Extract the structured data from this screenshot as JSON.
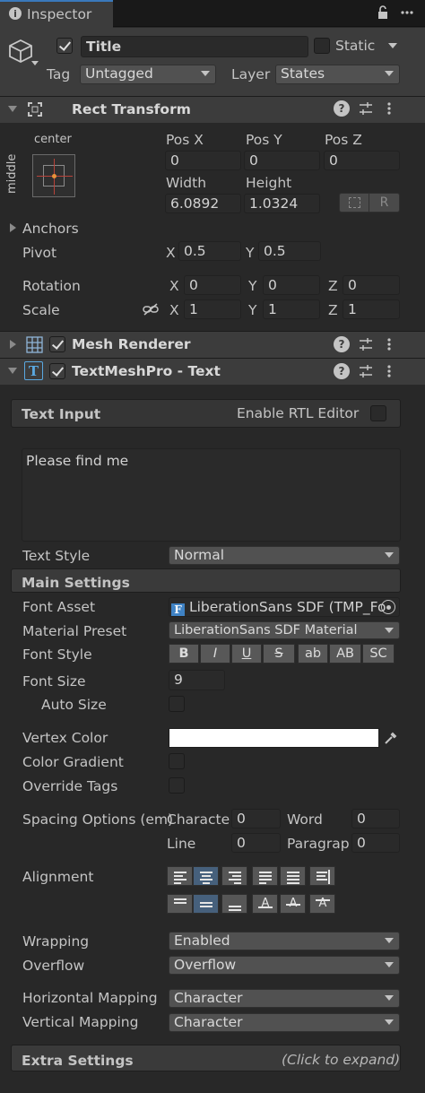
{
  "tab": {
    "title": "Inspector"
  },
  "header": {
    "active": true,
    "name": "Title",
    "static_label": "Static",
    "tag_label": "Tag",
    "tag_value": "Untagged",
    "layer_label": "Layer",
    "layer_value": "States"
  },
  "rect_transform": {
    "title": "Rect Transform",
    "anchor_h": "center",
    "anchor_v": "middle",
    "pos_x_label": "Pos X",
    "pos_x": "0",
    "pos_y_label": "Pos Y",
    "pos_y": "0",
    "pos_z_label": "Pos Z",
    "pos_z": "0",
    "width_label": "Width",
    "width": "6.0892",
    "height_label": "Height",
    "height": "1.0324",
    "r_button": "R",
    "anchors_label": "Anchors",
    "pivot_label": "Pivot",
    "pivot_x_label": "X",
    "pivot_x": "0.5",
    "pivot_y_label": "Y",
    "pivot_y": "0.5",
    "rotation_label": "Rotation",
    "rot_x_label": "X",
    "rot_x": "0",
    "rot_y_label": "Y",
    "rot_y": "0",
    "rot_z_label": "Z",
    "rot_z": "0",
    "scale_label": "Scale",
    "scale_x_label": "X",
    "scale_x": "1",
    "scale_y_label": "Y",
    "scale_y": "1",
    "scale_z_label": "Z",
    "scale_z": "1"
  },
  "mesh_renderer": {
    "title": "Mesh Renderer",
    "enabled": true
  },
  "tmp": {
    "title": "TextMeshPro - Text",
    "enabled": true,
    "text_input_label": "Text Input",
    "rtl_label": "Enable RTL Editor",
    "text": "Please find me",
    "text_style_label": "Text Style",
    "text_style": "Normal",
    "main_settings_label": "Main Settings",
    "font_asset_label": "Font Asset",
    "font_asset": "LiberationSans SDF (TMP_Fo",
    "material_preset_label": "Material Preset",
    "material_preset": "LiberationSans SDF Material",
    "font_style_label": "Font Style",
    "font_style_buttons": [
      "B",
      "I",
      "U",
      "S",
      "ab",
      "AB",
      "SC"
    ],
    "font_size_label": "Font Size",
    "font_size": "9",
    "auto_size_label": "Auto Size",
    "vertex_color_label": "Vertex Color",
    "vertex_color": "#ffffff",
    "color_gradient_label": "Color Gradient",
    "override_tags_label": "Override Tags",
    "spacing_label": "Spacing Options (em)",
    "char_label": "Characte",
    "char_value": "0",
    "word_label": "Word",
    "word_value": "0",
    "line_label": "Line",
    "line_value": "0",
    "para_label": "Paragrap",
    "para_value": "0",
    "alignment_label": "Alignment",
    "horizontal_alignment": "center",
    "vertical_alignment": "middle",
    "wrapping_label": "Wrapping",
    "wrapping": "Enabled",
    "overflow_label": "Overflow",
    "overflow": "Overflow",
    "hmap_label": "Horizontal Mapping",
    "hmap": "Character",
    "vmap_label": "Vertical Mapping",
    "vmap": "Character",
    "extra_settings_label": "Extra Settings",
    "extra_hint": "(Click to expand)"
  },
  "colors": {
    "accent_selected": "#46607c",
    "field_bg": "#2a2a2a",
    "header_bg": "#3c3c3c"
  }
}
